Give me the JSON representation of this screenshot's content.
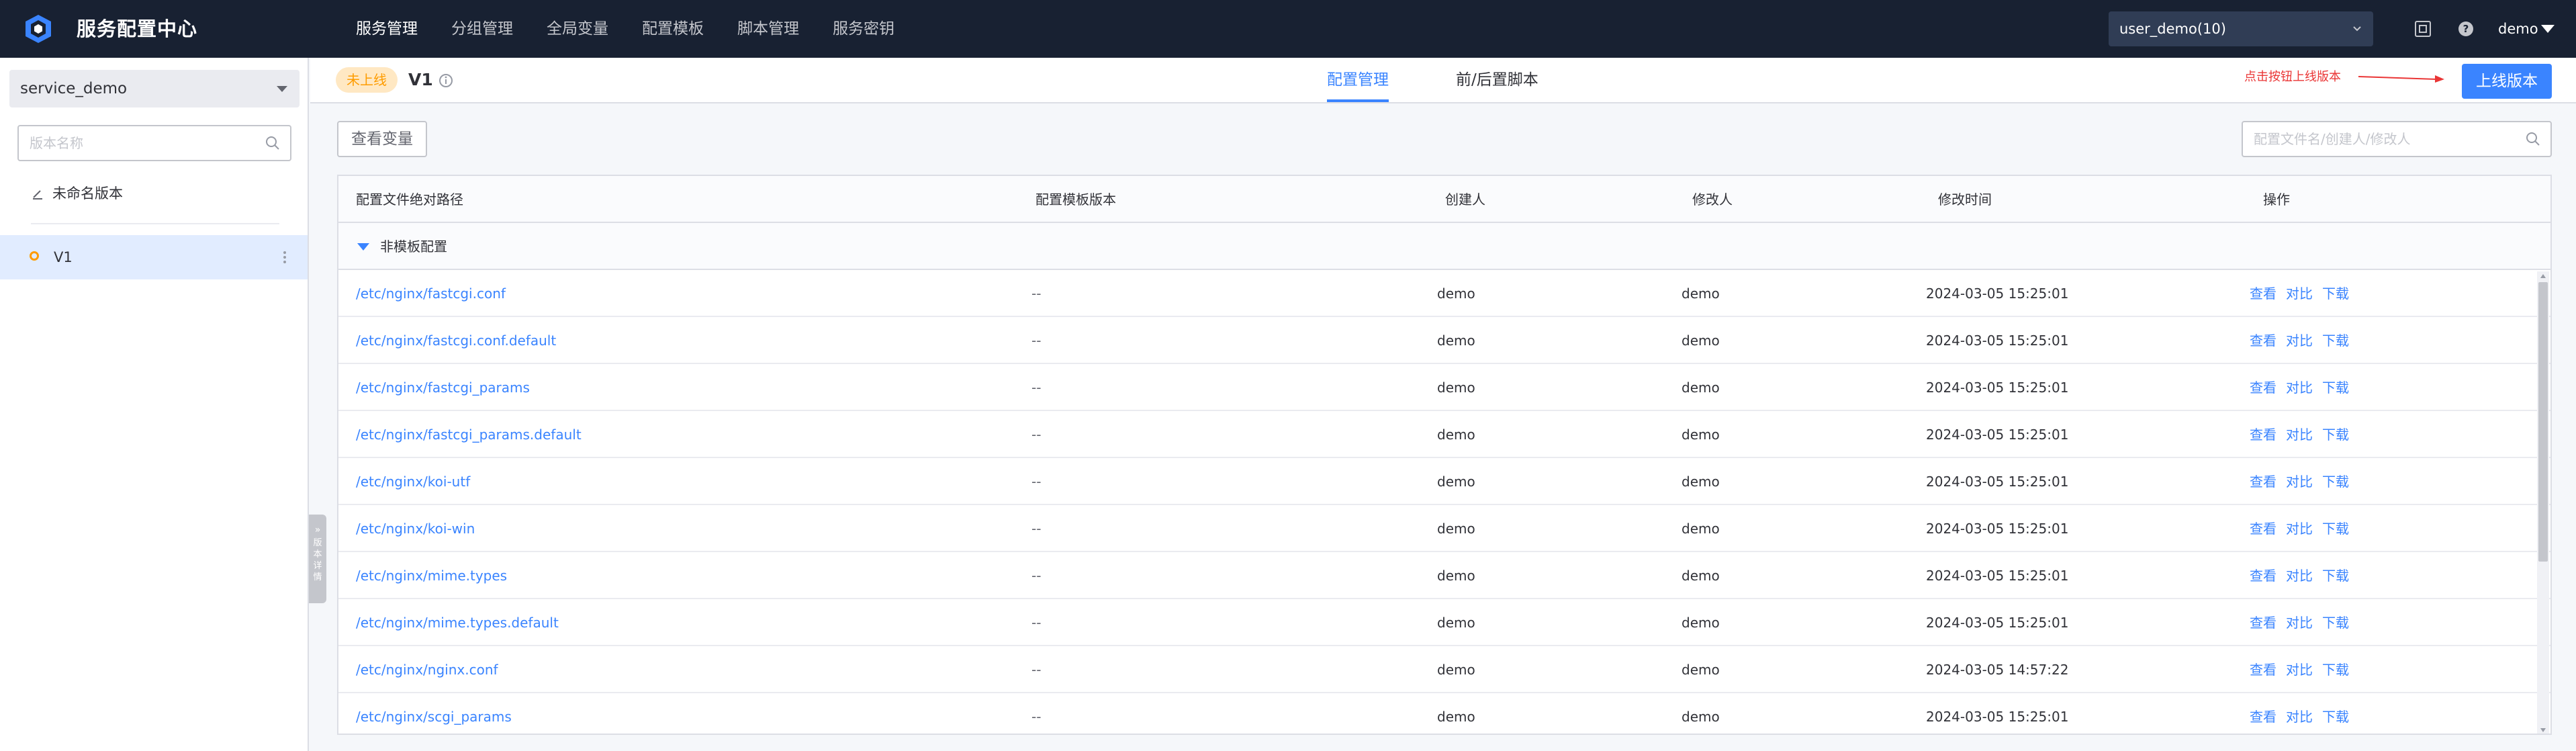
{
  "app": {
    "title": "服务配置中心"
  },
  "nav": {
    "items": [
      {
        "label": "服务管理",
        "active": true
      },
      {
        "label": "分组管理",
        "active": false
      },
      {
        "label": "全局变量",
        "active": false
      },
      {
        "label": "配置模板",
        "active": false
      },
      {
        "label": "脚本管理",
        "active": false
      },
      {
        "label": "服务密钥",
        "active": false
      }
    ],
    "business_select": "user_demo(10)",
    "user": "demo"
  },
  "sidebar": {
    "service_select": "service_demo",
    "search_placeholder": "版本名称",
    "unnamed_version": "未命名版本",
    "versions": [
      {
        "label": "V1"
      }
    ],
    "collapse_label": "版本详情"
  },
  "header": {
    "status_tag": "未上线",
    "version_title": "V1",
    "tabs": [
      {
        "label": "配置管理",
        "active": true
      },
      {
        "label": "前/后置脚本",
        "active": false
      }
    ],
    "hint": "点击按钮上线版本",
    "publish_button": "上线版本"
  },
  "toolbar": {
    "view_vars_button": "查看变量",
    "search_placeholder": "配置文件名/创建人/修改人"
  },
  "table": {
    "columns": [
      "配置文件绝对路径",
      "配置模板版本",
      "创建人",
      "修改人",
      "修改时间",
      "操作"
    ],
    "group_label": "非模板配置",
    "actions": [
      "查看",
      "对比",
      "下载"
    ],
    "rows": [
      {
        "path": "/etc/nginx/fastcgi.conf",
        "template_version": "--",
        "creator": "demo",
        "reviser": "demo",
        "updated": "2024-03-05 15:25:01"
      },
      {
        "path": "/etc/nginx/fastcgi.conf.default",
        "template_version": "--",
        "creator": "demo",
        "reviser": "demo",
        "updated": "2024-03-05 15:25:01"
      },
      {
        "path": "/etc/nginx/fastcgi_params",
        "template_version": "--",
        "creator": "demo",
        "reviser": "demo",
        "updated": "2024-03-05 15:25:01"
      },
      {
        "path": "/etc/nginx/fastcgi_params.default",
        "template_version": "--",
        "creator": "demo",
        "reviser": "demo",
        "updated": "2024-03-05 15:25:01"
      },
      {
        "path": "/etc/nginx/koi-utf",
        "template_version": "--",
        "creator": "demo",
        "reviser": "demo",
        "updated": "2024-03-05 15:25:01"
      },
      {
        "path": "/etc/nginx/koi-win",
        "template_version": "--",
        "creator": "demo",
        "reviser": "demo",
        "updated": "2024-03-05 15:25:01"
      },
      {
        "path": "/etc/nginx/mime.types",
        "template_version": "--",
        "creator": "demo",
        "reviser": "demo",
        "updated": "2024-03-05 15:25:01"
      },
      {
        "path": "/etc/nginx/mime.types.default",
        "template_version": "--",
        "creator": "demo",
        "reviser": "demo",
        "updated": "2024-03-05 15:25:01"
      },
      {
        "path": "/etc/nginx/nginx.conf",
        "template_version": "--",
        "creator": "demo",
        "reviser": "demo",
        "updated": "2024-03-05 14:57:22"
      },
      {
        "path": "/etc/nginx/scgi_params",
        "template_version": "--",
        "creator": "demo",
        "reviser": "demo",
        "updated": "2024-03-05 15:25:01"
      }
    ]
  },
  "colors": {
    "nav_bg": "#182132",
    "primary": "#3a84ff",
    "warning": "#ff9c01",
    "danger": "#ea3636"
  },
  "icons": [
    "logo-icon",
    "chevron-down-icon",
    "qrcode-icon",
    "help-icon",
    "search-icon",
    "edit-icon",
    "more-icon",
    "info-icon",
    "arrow-right-icon"
  ]
}
